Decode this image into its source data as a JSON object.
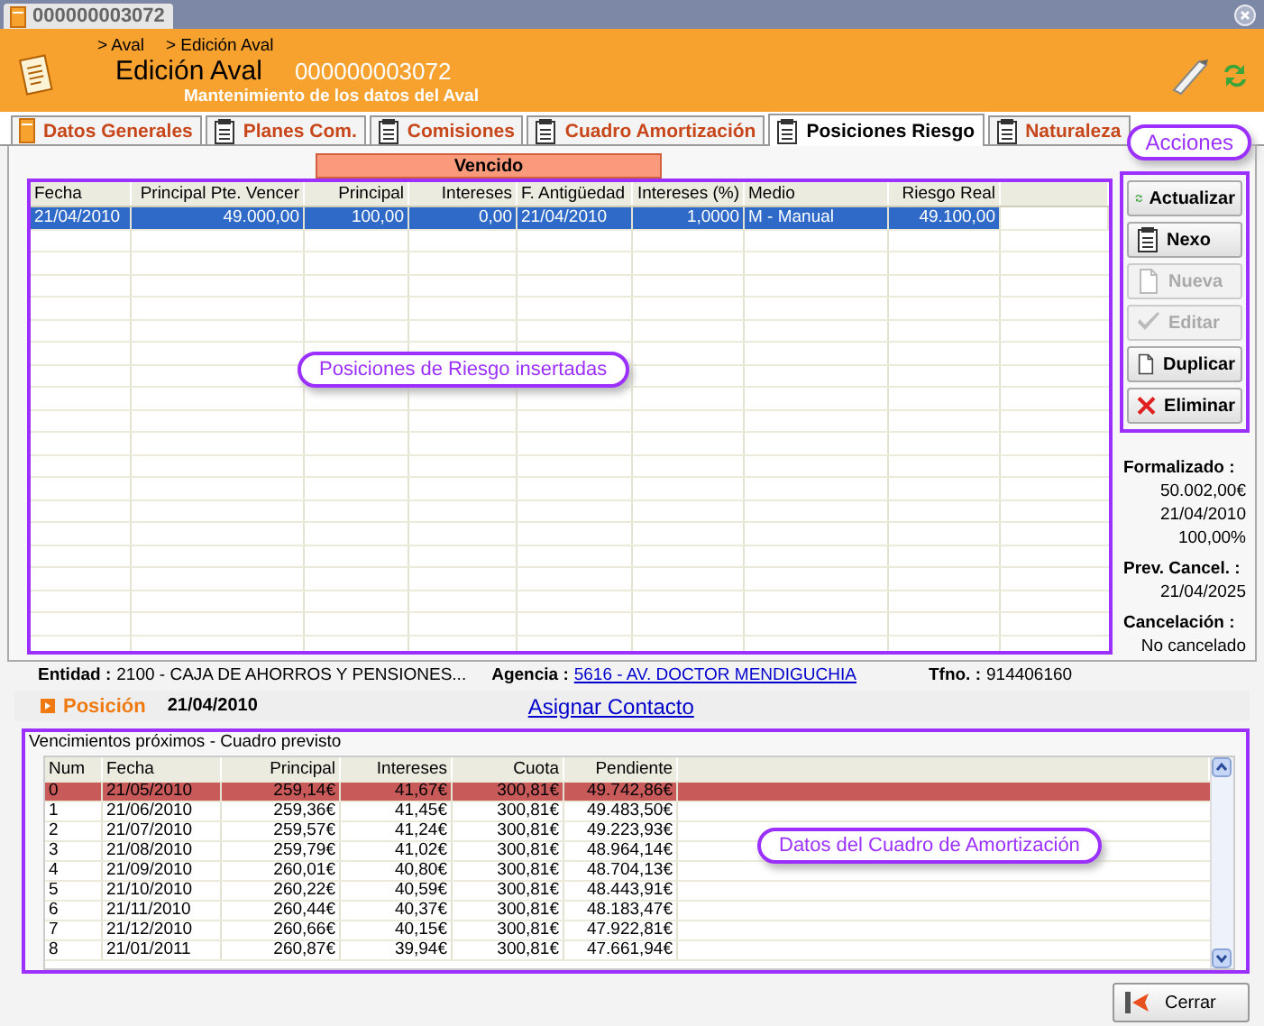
{
  "window": {
    "title": "000000003072"
  },
  "header": {
    "breadcrumb": [
      "> Aval",
      "> Edición Aval"
    ],
    "title": "Edición Aval",
    "number": "000000003072",
    "subtitle": "Mantenimiento de los datos del Aval"
  },
  "tabs": [
    {
      "label": "Datos Generales",
      "selected": false
    },
    {
      "label": "Planes Com.",
      "selected": false
    },
    {
      "label": "Comisiones",
      "selected": false
    },
    {
      "label": "Cuadro Amortización",
      "selected": false
    },
    {
      "label": "Posiciones Riesgo",
      "selected": true
    },
    {
      "label": "Naturaleza",
      "selected": false
    }
  ],
  "positions": {
    "group_header": "Vencido",
    "columns": [
      "Fecha",
      "Principal Pte. Vencer",
      "Principal",
      "Intereses",
      "F. Antigüedad",
      "Intereses (%)",
      "Medio",
      "Riesgo Real"
    ],
    "rows": [
      {
        "cells": [
          "21/04/2010",
          "49.000,00",
          "100,00",
          "0,00",
          "21/04/2010",
          "1,0000",
          "M - Manual",
          "49.100,00"
        ],
        "selected": true
      }
    ],
    "annotation": "Posiciones de Riesgo insertadas"
  },
  "actions": {
    "annotation": "Acciones",
    "buttons": [
      {
        "label": "Actualizar",
        "disabled": false
      },
      {
        "label": "Nexo",
        "disabled": false
      },
      {
        "label": "Nueva",
        "disabled": true
      },
      {
        "label": "Editar",
        "disabled": true
      },
      {
        "label": "Duplicar",
        "disabled": false
      },
      {
        "label": "Eliminar",
        "disabled": false
      }
    ]
  },
  "summary": [
    {
      "label": "Formalizado :",
      "values": [
        "50.002,00€",
        "21/04/2010",
        "100,00%"
      ]
    },
    {
      "label": "Prev. Cancel. :",
      "values": [
        "21/04/2025"
      ]
    },
    {
      "label": "Cancelación :",
      "values": [
        "No cancelado"
      ]
    }
  ],
  "details": {
    "entidad_label": "Entidad :",
    "entidad": "2100 - CAJA DE AHORROS Y PENSIONES...",
    "agencia_label": "Agencia :",
    "agencia": "5616 - AV. DOCTOR MENDIGUCHIA",
    "tfno_label": "Tfno. :",
    "tfno": "914406160"
  },
  "position": {
    "label": "Posición",
    "date": "21/04/2010",
    "link": "Asignar Contacto"
  },
  "schedule": {
    "title": "Vencimientos próximos - Cuadro previsto",
    "columns": [
      "Num",
      "Fecha",
      "Principal",
      "Intereses",
      "Cuota",
      "Pendiente"
    ],
    "rows": [
      {
        "cells": [
          "0",
          "21/05/2010",
          "259,14€",
          "41,67€",
          "300,81€",
          "49.742,86€"
        ],
        "highlighted": true
      },
      {
        "cells": [
          "1",
          "21/06/2010",
          "259,36€",
          "41,45€",
          "300,81€",
          "49.483,50€"
        ],
        "highlighted": false
      },
      {
        "cells": [
          "2",
          "21/07/2010",
          "259,57€",
          "41,24€",
          "300,81€",
          "49.223,93€"
        ],
        "highlighted": false
      },
      {
        "cells": [
          "3",
          "21/08/2010",
          "259,79€",
          "41,02€",
          "300,81€",
          "48.964,14€"
        ],
        "highlighted": false
      },
      {
        "cells": [
          "4",
          "21/09/2010",
          "260,01€",
          "40,80€",
          "300,81€",
          "48.704,13€"
        ],
        "highlighted": false
      },
      {
        "cells": [
          "5",
          "21/10/2010",
          "260,22€",
          "40,59€",
          "300,81€",
          "48.443,91€"
        ],
        "highlighted": false
      },
      {
        "cells": [
          "6",
          "21/11/2010",
          "260,44€",
          "40,37€",
          "300,81€",
          "48.183,47€"
        ],
        "highlighted": false
      },
      {
        "cells": [
          "7",
          "21/12/2010",
          "260,66€",
          "40,15€",
          "300,81€",
          "47.922,81€"
        ],
        "highlighted": false
      },
      {
        "cells": [
          "8",
          "21/01/2011",
          "260,87€",
          "39,94€",
          "300,81€",
          "47.661,94€"
        ],
        "highlighted": false
      }
    ],
    "annotation": "Datos del Cuadro de Amortización"
  },
  "buttons": [
    {
      "label": "Cerrar"
    }
  ]
}
